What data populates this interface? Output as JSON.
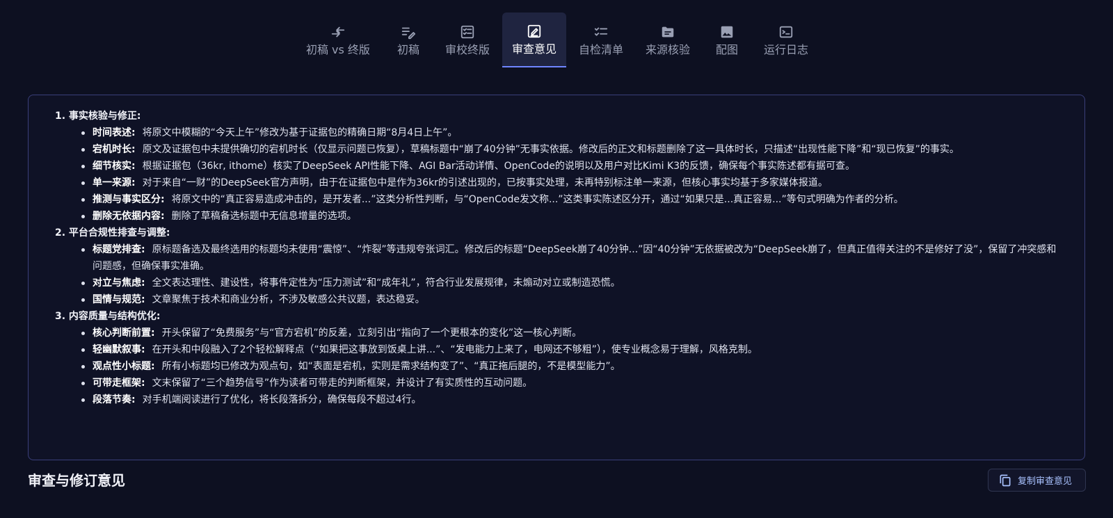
{
  "tabs": [
    {
      "label": "初稿 vs 终版",
      "icon": "compare-arrows-icon"
    },
    {
      "label": "初稿",
      "icon": "edit-note-icon"
    },
    {
      "label": "审校终版",
      "icon": "checklist-box-icon"
    },
    {
      "label": "审查意见",
      "icon": "review-edit-icon",
      "active": true
    },
    {
      "label": "自检清单",
      "icon": "checklist-icon"
    },
    {
      "label": "来源核验",
      "icon": "folder-icon"
    },
    {
      "label": "配图",
      "icon": "image-icon"
    },
    {
      "label": "运行日志",
      "icon": "terminal-icon"
    }
  ],
  "review": {
    "sections": [
      {
        "title": "1. 事实核验与修正:",
        "items": [
          {
            "label": "时间表述:",
            "text": "将原文中模糊的“今天上午”修改为基于证据包的精确日期“8月4日上午”。"
          },
          {
            "label": "宕机时长:",
            "text": "原文及证据包中未提供确切的宕机时长（仅显示问题已恢复），草稿标题中“崩了40分钟”无事实依据。修改后的正文和标题删除了这一具体时长，只描述“出现性能下降”和“现已恢复”的事实。"
          },
          {
            "label": "细节核实:",
            "text": "根据证据包（36kr, ithome）核实了DeepSeek API性能下降、AGI Bar活动详情、OpenCode的说明以及用户对比Kimi K3的反馈，确保每个事实陈述都有据可查。"
          },
          {
            "label": "单一来源:",
            "text": "对于来自“一财”的DeepSeek官方声明，由于在证据包中是作为36kr的引述出现的，已按事实处理，未再特别标注单一来源，但核心事实均基于多家媒体报道。"
          },
          {
            "label": "推测与事实区分:",
            "text": "将原文中的“真正容易造成冲击的，是开发者...”这类分析性判断，与“OpenCode发文称...”这类事实陈述区分开，通过“如果只是...真正容易...”等句式明确为作者的分析。"
          },
          {
            "label": "删除无依据内容:",
            "text": "删除了草稿备选标题中无信息增量的选项。"
          }
        ]
      },
      {
        "title": "2. 平台合规性排查与调整:",
        "items": [
          {
            "label": "标题党排查:",
            "text": "原标题备选及最终选用的标题均未使用“震惊”、“炸裂”等违规夸张词汇。修改后的标题“DeepSeek崩了40分钟...”因“40分钟”无依据被改为“DeepSeek崩了，但真正值得关注的不是修好了没”，保留了冲突感和问题感，但确保事实准确。"
          },
          {
            "label": "对立与焦虑:",
            "text": "全文表达理性、建设性，将事件定性为“压力测试”和“成年礼”，符合行业发展规律，未煽动对立或制造恐慌。"
          },
          {
            "label": "国情与规范:",
            "text": "文章聚焦于技术和商业分析，不涉及敏感公共议题，表达稳妥。"
          }
        ]
      },
      {
        "title": "3. 内容质量与结构优化:",
        "items": [
          {
            "label": "核心判断前置:",
            "text": "开头保留了“免费服务”与“官方宕机”的反差，立刻引出“指向了一个更根本的变化”这一核心判断。"
          },
          {
            "label": "轻幽默叙事:",
            "text": "在开头和中段融入了2个轻松解释点（“如果把这事放到饭桌上讲...”、“发电能力上来了，电网还不够粗”），使专业概念易于理解，风格克制。"
          },
          {
            "label": "观点性小标题:",
            "text": "所有小标题均已修改为观点句，如“表面是宕机，实则是需求结构变了”、“真正拖后腿的，不是模型能力”。"
          },
          {
            "label": "可带走框架:",
            "text": "文末保留了“三个趋势信号”作为读者可带走的判断框架，并设计了有实质性的互动问题。"
          },
          {
            "label": "段落节奏:",
            "text": "对手机端阅读进行了优化，将长段落拆分，确保每段不超过4行。"
          }
        ]
      }
    ]
  },
  "footer": {
    "title": "审查与修订意见",
    "copy_button_label": "复制审查意见",
    "copy_icon": "copy-icon"
  },
  "colors": {
    "background": "#0d1021",
    "accent": "#6f86ff",
    "panel_border": "#3a3f7a",
    "button_text": "#a9c2ff"
  }
}
